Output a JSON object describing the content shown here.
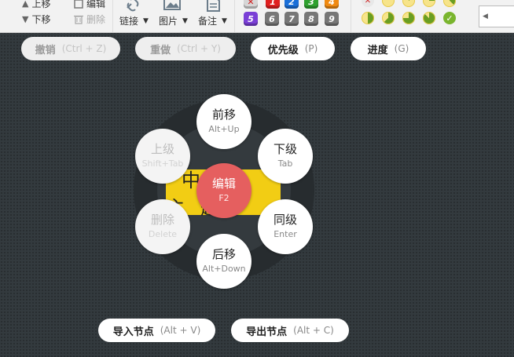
{
  "toolbar": {
    "move_up": "上移",
    "move_down": "下移",
    "edit": "编辑",
    "delete": "删除",
    "link": "链接",
    "image": "图片",
    "note": "备注",
    "priorities": [
      "1",
      "2",
      "3",
      "4",
      "5",
      "6",
      "7",
      "8",
      "9"
    ],
    "priority_colors": {
      "clear": "#cfcfcf",
      "1": "#e02020",
      "2": "#1a6fd8",
      "3": "#2fa12f",
      "4": "#f08a12",
      "5": "#7a3fd6",
      "6": "#777777",
      "7": "#777777",
      "8": "#777777",
      "9": "#777777"
    },
    "progress_levels": [
      0,
      0,
      0.125,
      0.25,
      0.375,
      0.5,
      0.625,
      0.75,
      0.875,
      1
    ]
  },
  "shortcuts": {
    "undo": {
      "label": "撤销",
      "key": "(Ctrl + Z)"
    },
    "redo": {
      "label": "重做",
      "key": "(Ctrl + Y)"
    },
    "priority": {
      "label": "优先级",
      "key": "(P)"
    },
    "progress": {
      "label": "进度",
      "key": "(G)"
    },
    "import_node": {
      "label": "导入节点",
      "key": "(Alt + V)"
    },
    "export_node": {
      "label": "导出节点",
      "key": "(Alt + C)"
    }
  },
  "topic": {
    "text": "中心主题"
  },
  "radial_menu": {
    "center": {
      "label": "编辑",
      "key": "F2"
    },
    "move_up": {
      "label": "前移",
      "key": "Alt+Up"
    },
    "child": {
      "label": "下级",
      "key": "Tab"
    },
    "sibling": {
      "label": "同级",
      "key": "Enter"
    },
    "move_down": {
      "label": "后移",
      "key": "Alt+Down"
    },
    "delete": {
      "label": "删除",
      "key": "Delete"
    },
    "parent": {
      "label": "上级",
      "key": "Shift+Tab"
    }
  }
}
